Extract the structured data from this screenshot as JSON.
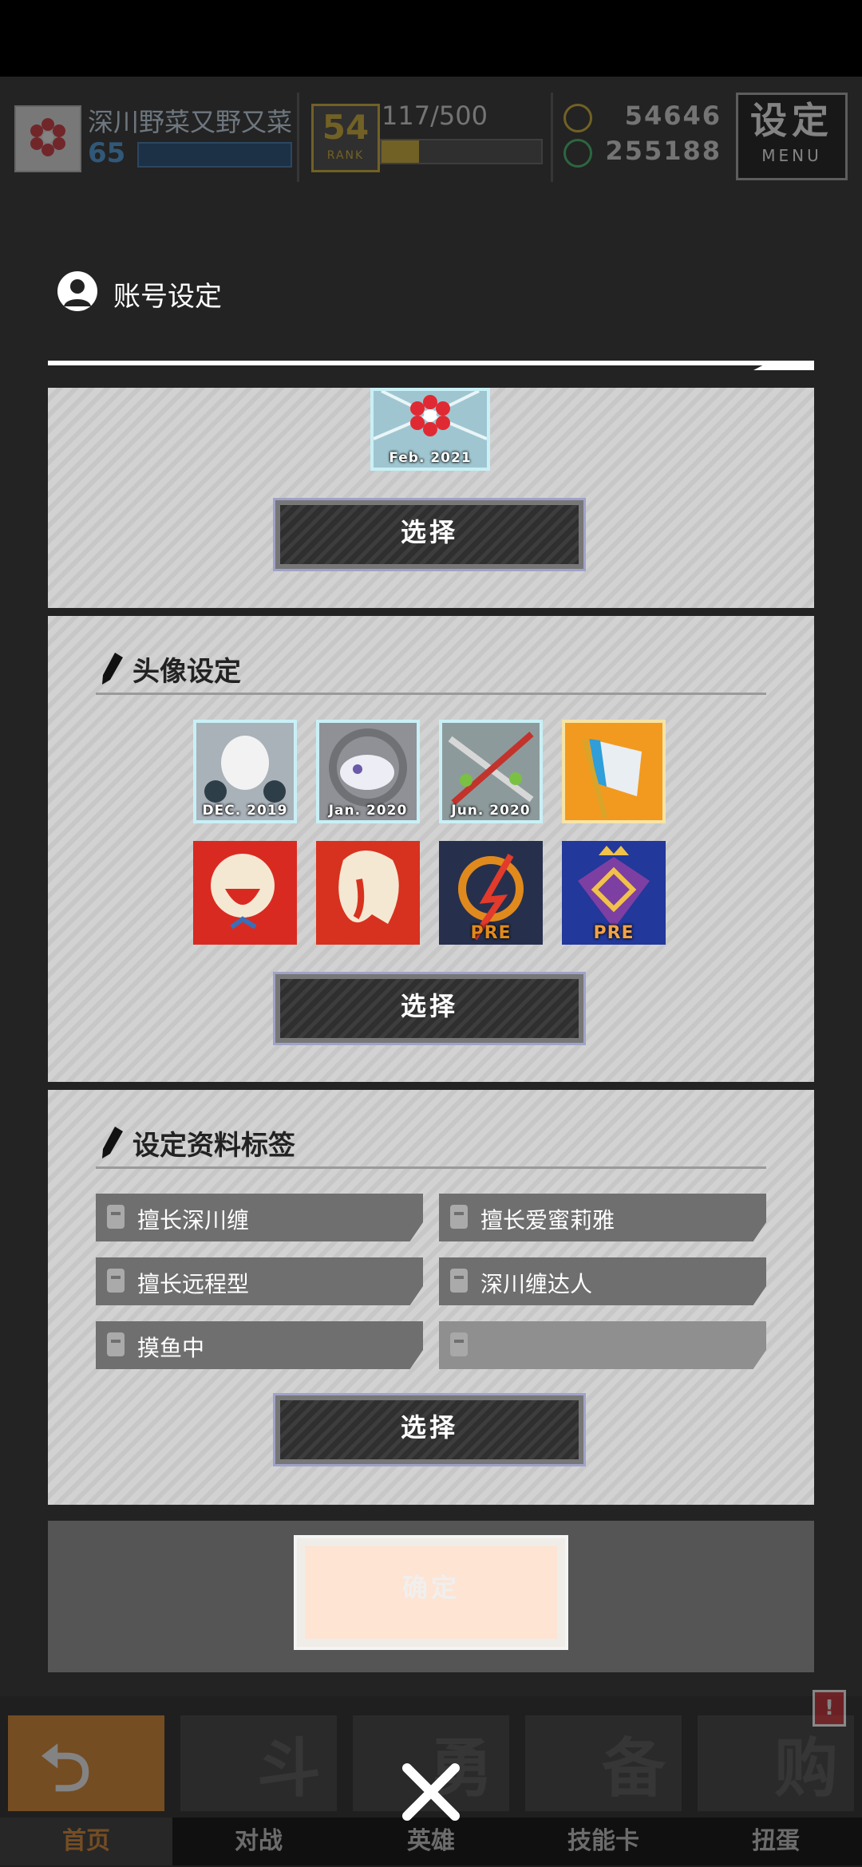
{
  "header": {
    "player_name": "深川野菜又野又菜",
    "level": "65",
    "rank": "54",
    "rank_label": "RANK",
    "exp": "117/500",
    "exp_progress": 0.234,
    "gold": "54646",
    "gems": "255188",
    "settings_label": "设定",
    "settings_sub": "MENU",
    "avatar_badge_date": "Feb. 2021"
  },
  "dialog": {
    "title": "账号设定",
    "frame_section": {
      "current_badge_date": "Feb. 2021",
      "select_label": "选择"
    },
    "avatar_section": {
      "title": "头像设定",
      "badges": [
        {
          "date": "DEC. 2019",
          "color": "#a9b1b9"
        },
        {
          "date": "Jan. 2020",
          "color": "#8f9196"
        },
        {
          "date": "Jun. 2020",
          "color": "#8d9a9b"
        },
        {
          "date": "",
          "color": "#f29a1f"
        },
        {
          "date": "",
          "color": "#d92a22"
        },
        {
          "date": "",
          "color": "#d7321f"
        },
        {
          "date": "PRE",
          "color": "#26304d"
        },
        {
          "date": "PRE",
          "color": "#22389b"
        }
      ],
      "select_label": "选择"
    },
    "tags_section": {
      "title": "设定资料标签",
      "tags": [
        "擅长深川缠",
        "擅长爱蜜莉雅",
        "擅长远程型",
        "深川缠达人",
        "摸鱼中",
        ""
      ],
      "select_label": "选择"
    },
    "confirm_label": "确定"
  },
  "nav": {
    "items": [
      {
        "label": "首页",
        "glyph": "⮌"
      },
      {
        "label": "对战",
        "glyph": "斗"
      },
      {
        "label": "英雄",
        "glyph": "勇"
      },
      {
        "label": "技能卡",
        "glyph": "备"
      },
      {
        "label": "扭蛋",
        "glyph": "购"
      }
    ],
    "alert": "!"
  }
}
